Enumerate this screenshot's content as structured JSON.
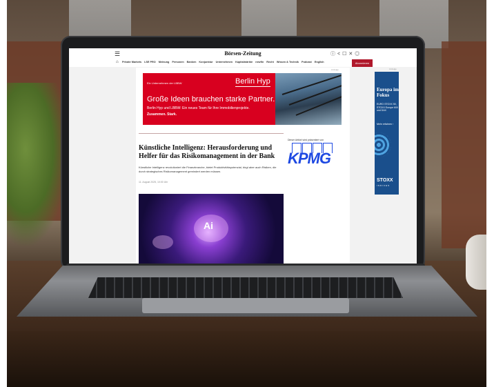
{
  "page": {
    "logo": "Börsen-Zeitung",
    "menu_icon": "hamburger-icon",
    "top_icons": [
      "info-icon",
      "share-icon",
      "bookmark-icon",
      "x-icon",
      "user-icon"
    ],
    "nav": [
      "Private Markets",
      "LSE PRO",
      "Meinung",
      "Personen",
      "Banken",
      "Konjunktur",
      "Unternehmen",
      "Kapitalmärkte",
      "newfin",
      "Recht",
      "Wissen & Technik",
      "Podcast",
      "English"
    ],
    "subscribe": "Abonnieren"
  },
  "ad": {
    "label": "Anzeige",
    "top_line": "Ein Unternehmen der LBBW",
    "brand": "Berlin Hyp",
    "headline": "Große Ideen brauchen starke Partner.",
    "subline": "Berlin Hyp und LBBW: Ein neues Team für Ihre Immobilienprojekte.",
    "tagline": "Zusammen. Stark."
  },
  "article": {
    "headline": "Künstliche Intelligenz: Herausforderung und Helfer für das Risikomanagement in der Bank",
    "teaser": "Künstliche Intelligenz revolutioniert die Finanzbranche, bietet Produktivitätspotenzial, birgt aber auch Risiken, die durch strategisches Risikomanagement gemindert werden müssen.",
    "date": "11. August 2025, 10:00 Uhr",
    "sponsor_label": "Dieser Artikel wird präsentiert von",
    "sponsor": "KPMG",
    "image_label": "Ai"
  },
  "side_ad": {
    "label": "Anzeige",
    "title": "Europa im Fokus",
    "body": "EURO STOXX 50, STOXX Europe 600 und DAX",
    "link": "Mehr erfahren ›",
    "brand": "STOXX",
    "sub": "INDICES"
  }
}
